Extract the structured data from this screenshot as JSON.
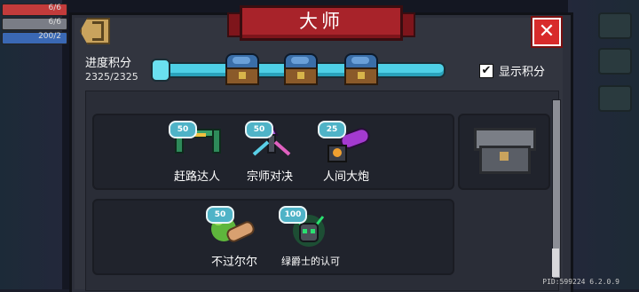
{
  "hud": {
    "hp": "6/6",
    "armor": "6/6",
    "energy": "200/2"
  },
  "dialog": {
    "title": "大师",
    "progress_label": "进度积分",
    "progress_value": "2325/2325",
    "progress_fraction": 1.0,
    "show_score_label": "显示积分",
    "show_score_checked": true,
    "checkmark": "✔",
    "close_glyph": "✕"
  },
  "achievements": [
    {
      "badge": "50",
      "label": "赶路达人",
      "icon": "green-fence-icon"
    },
    {
      "badge": "50",
      "label": "宗师对决",
      "icon": "crystal-swords-icon"
    },
    {
      "badge": "25",
      "label": "人间大炮",
      "icon": "purple-cannon-icon"
    },
    {
      "badge": "50",
      "label": "不过尔尔",
      "icon": "green-hand-icon"
    },
    {
      "badge": "100",
      "label": "绿爵士的认可",
      "icon": "horned-skull-icon"
    }
  ],
  "version": "PID:599224 6.2.0.9",
  "colors": {
    "title_ribbon": "#a8232a",
    "progress_bar": "#4ed0e6",
    "badge": "#4fb3c7",
    "close_button": "#d82b2b"
  }
}
